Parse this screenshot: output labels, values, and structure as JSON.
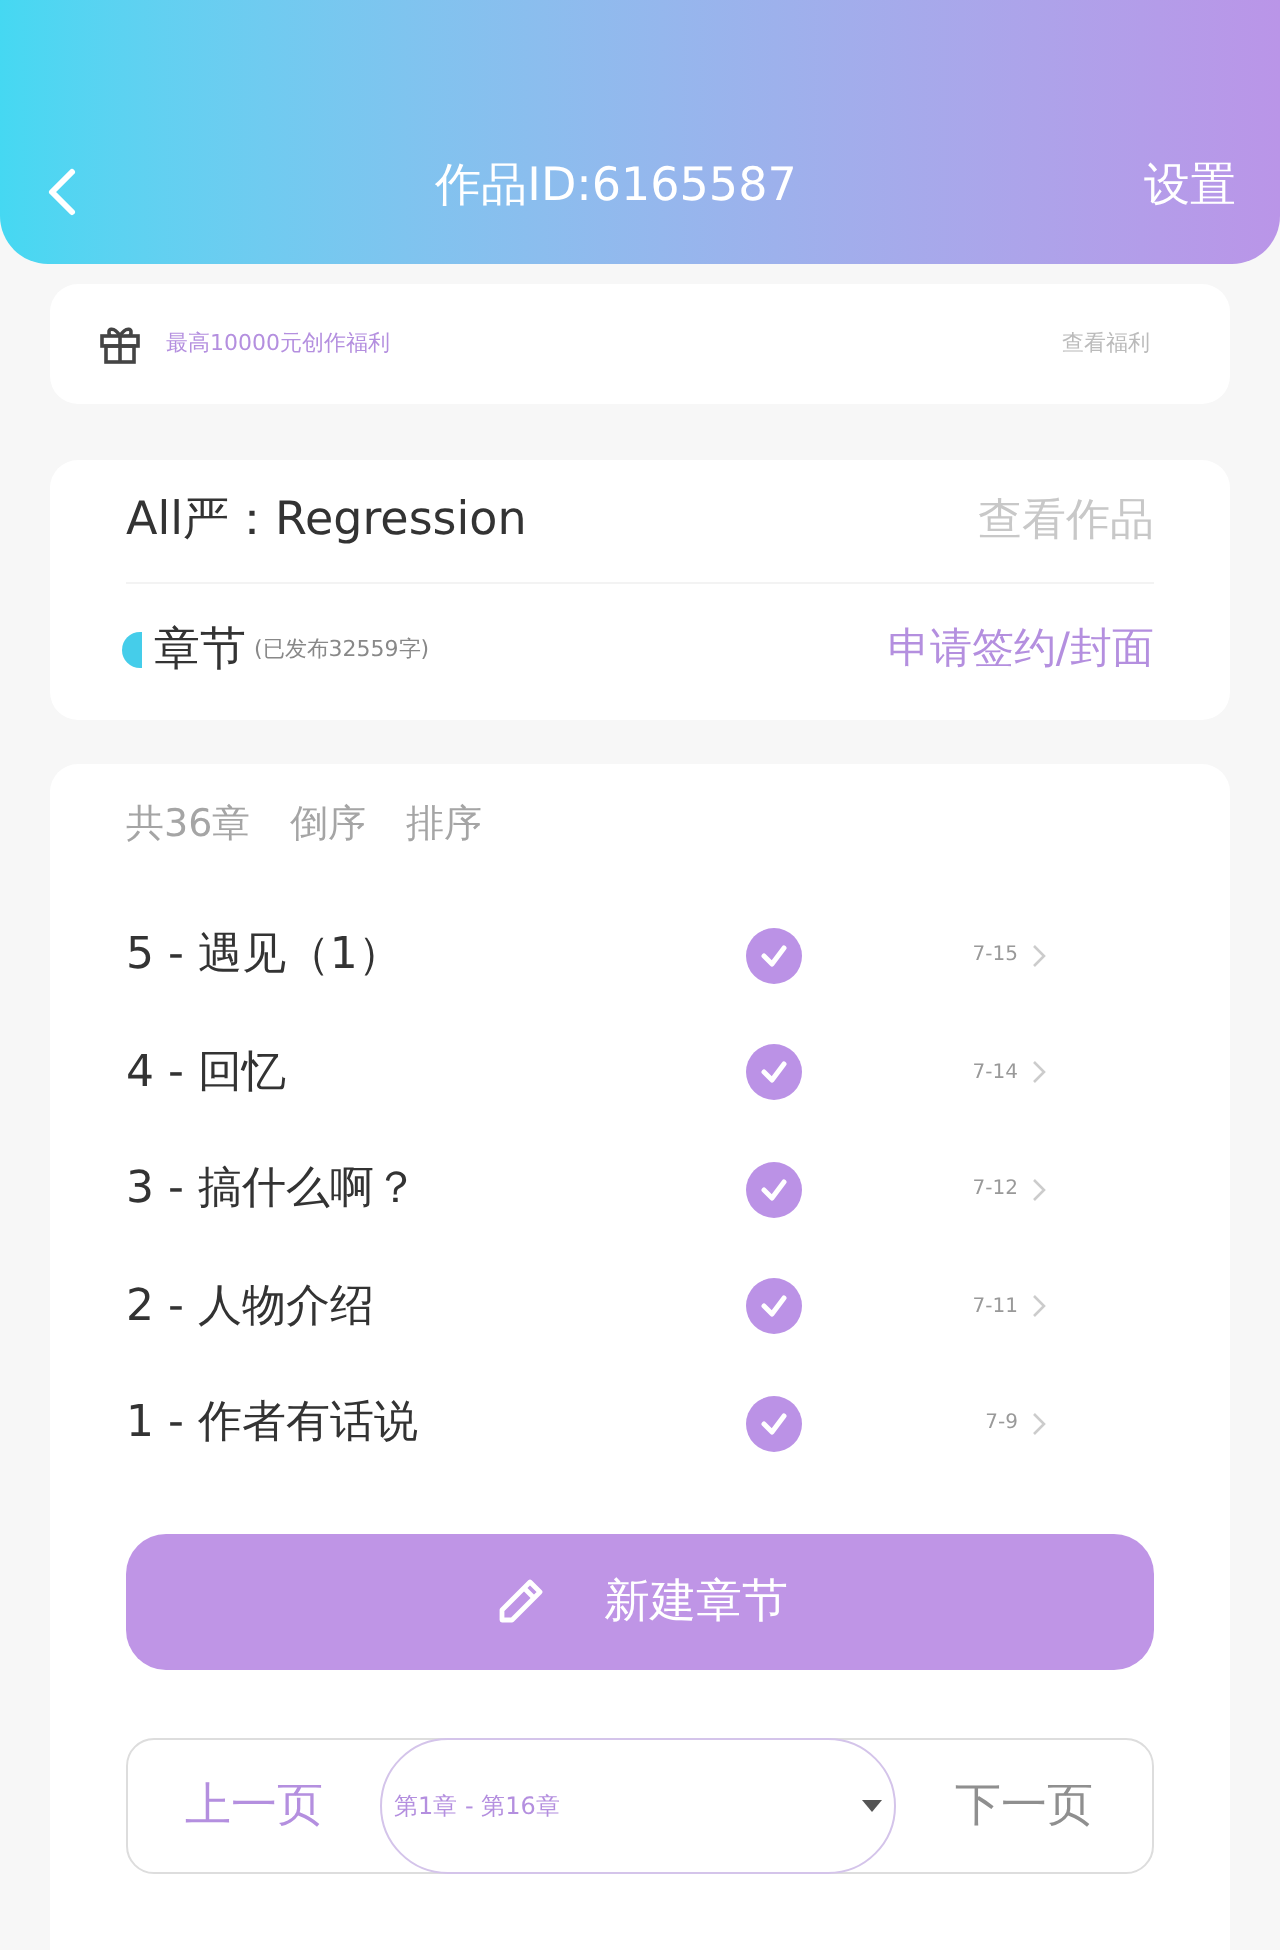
{
  "header": {
    "title": "作品ID:6165587",
    "action": "设置"
  },
  "promo": {
    "text": "最高10000元创作福利",
    "link": "查看福利"
  },
  "work": {
    "title": "All严：Regression",
    "view": "查看作品",
    "section": "章节",
    "published": "(已发布32559字)",
    "apply": "申请签约/封面"
  },
  "list_toolbar": {
    "count": "共36章",
    "reverse": "倒序",
    "sort": "排序"
  },
  "chapters": [
    {
      "title": "5 - 遇见（1）",
      "published": true,
      "date": "7-15"
    },
    {
      "title": "4 - 回忆",
      "published": true,
      "date": "7-14"
    },
    {
      "title": "3 - 搞什么啊？",
      "published": true,
      "date": "7-12"
    },
    {
      "title": "2 - 人物介绍",
      "published": true,
      "date": "7-11"
    },
    {
      "title": "1 - 作者有话说",
      "published": true,
      "date": "7-9"
    }
  ],
  "new_chapter": "新建章节",
  "pagination": {
    "prev": {
      "label": "上一页",
      "disabled": false
    },
    "range": "第1章 - 第16章",
    "next": {
      "label": "下一页",
      "disabled": true
    }
  }
}
